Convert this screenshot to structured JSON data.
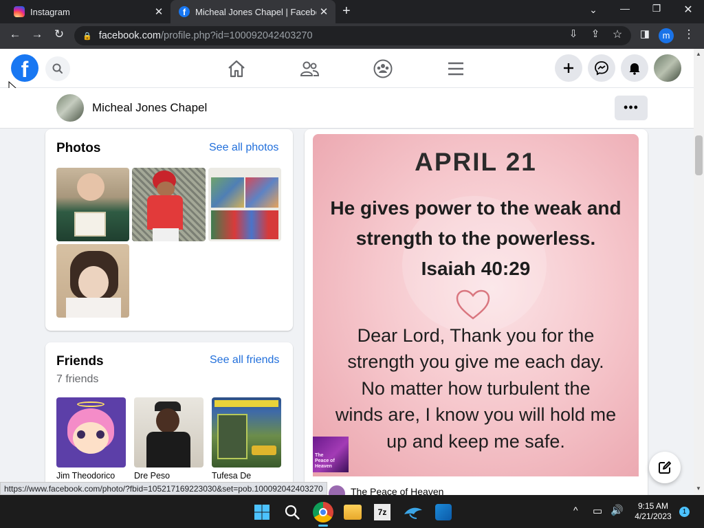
{
  "browser": {
    "tabs": [
      {
        "title": "Instagram",
        "icon": "instagram-icon"
      },
      {
        "title": "Micheal Jones Chapel | Facebook",
        "icon": "facebook-icon"
      }
    ],
    "url_domain": "facebook.com",
    "url_path": "/profile.php?id=100092042403270",
    "profile_initial": "m",
    "status_url": "https://www.facebook.com/photo/?fbid=105217169223030&set=pob.100092042403270"
  },
  "profile": {
    "name": "Micheal Jones Chapel",
    "more_label": "•••"
  },
  "photos": {
    "title": "Photos",
    "see_all": "See all photos"
  },
  "friends": {
    "title": "Friends",
    "see_all": "See all friends",
    "count": "7 friends",
    "names": [
      "Jim Theodorico",
      "Dre Peso",
      "Tufesa De"
    ]
  },
  "post": {
    "date": "APRIL 21",
    "verse_line1": "He gives power to the weak and",
    "verse_line2": "strength to the powerless.",
    "reference": "Isaiah 40:29",
    "prayer_lines": [
      "Dear Lord, Thank you for the",
      "strength you give me each day.",
      "No matter how turbulent the",
      "winds are, I know you will hold me",
      "up and keep me safe."
    ],
    "badge_lines": [
      "The",
      "Peace of",
      "Heaven"
    ],
    "author": "The Peace of Heaven"
  },
  "taskbar": {
    "time": "9:15 AM",
    "date": "4/21/2023",
    "notifications": "1"
  },
  "colors": {
    "facebook_blue": "#1877f2",
    "link_blue": "#216fdb",
    "chrome_dark": "#202124"
  }
}
